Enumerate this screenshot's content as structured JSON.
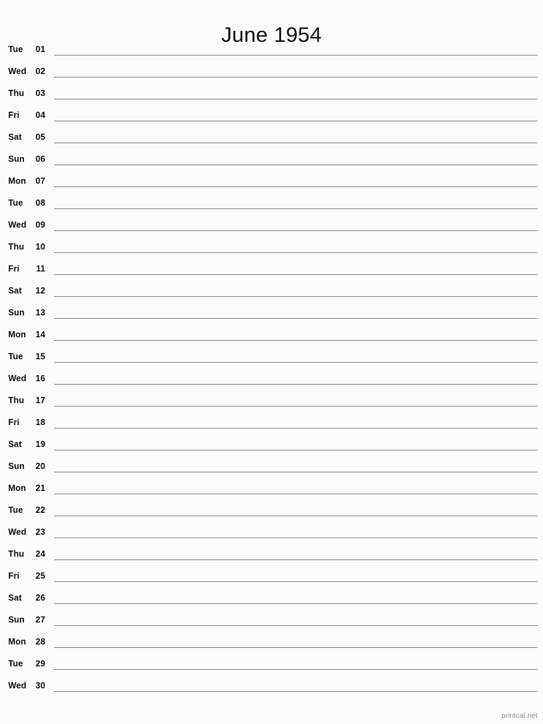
{
  "document": {
    "type": "printable-monthly-calendar",
    "title": "June 1954",
    "month": "June",
    "year": "1954"
  },
  "footer": {
    "site": "printcal.net"
  },
  "colors": {
    "background": "#fbfbf7",
    "text": "#0b0b0b",
    "title": "#121212",
    "rule": "#7f7f7f",
    "footer": "#8a8a8a"
  },
  "calendar": {
    "days": [
      {
        "weekday": "Tue",
        "date": "01"
      },
      {
        "weekday": "Wed",
        "date": "02"
      },
      {
        "weekday": "Thu",
        "date": "03"
      },
      {
        "weekday": "Fri",
        "date": "04"
      },
      {
        "weekday": "Sat",
        "date": "05"
      },
      {
        "weekday": "Sun",
        "date": "06"
      },
      {
        "weekday": "Mon",
        "date": "07"
      },
      {
        "weekday": "Tue",
        "date": "08"
      },
      {
        "weekday": "Wed",
        "date": "09"
      },
      {
        "weekday": "Thu",
        "date": "10"
      },
      {
        "weekday": "Fri",
        "date": "11"
      },
      {
        "weekday": "Sat",
        "date": "12"
      },
      {
        "weekday": "Sun",
        "date": "13"
      },
      {
        "weekday": "Mon",
        "date": "14"
      },
      {
        "weekday": "Tue",
        "date": "15"
      },
      {
        "weekday": "Wed",
        "date": "16"
      },
      {
        "weekday": "Thu",
        "date": "17"
      },
      {
        "weekday": "Fri",
        "date": "18"
      },
      {
        "weekday": "Sat",
        "date": "19"
      },
      {
        "weekday": "Sun",
        "date": "20"
      },
      {
        "weekday": "Mon",
        "date": "21"
      },
      {
        "weekday": "Tue",
        "date": "22"
      },
      {
        "weekday": "Wed",
        "date": "23"
      },
      {
        "weekday": "Thu",
        "date": "24"
      },
      {
        "weekday": "Fri",
        "date": "25"
      },
      {
        "weekday": "Sat",
        "date": "26"
      },
      {
        "weekday": "Sun",
        "date": "27"
      },
      {
        "weekday": "Mon",
        "date": "28"
      },
      {
        "weekday": "Tue",
        "date": "29"
      },
      {
        "weekday": "Wed",
        "date": "30"
      }
    ]
  }
}
